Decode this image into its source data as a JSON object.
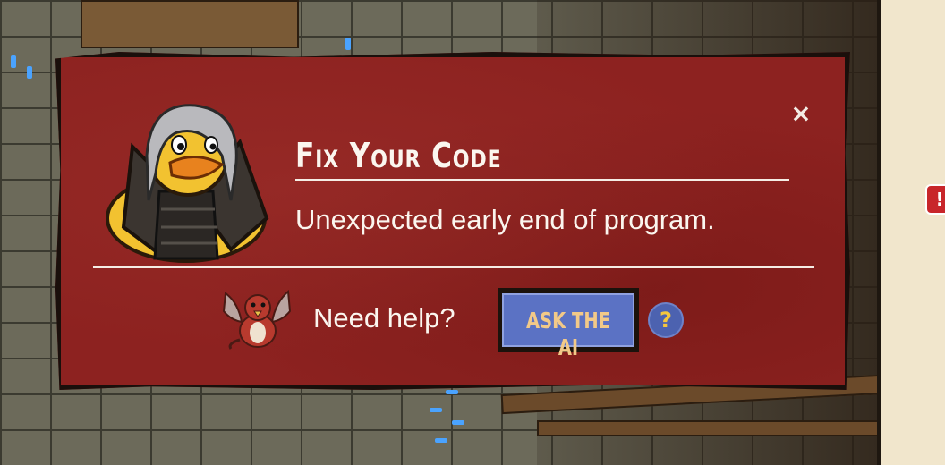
{
  "modal": {
    "title": "Fix Your Code",
    "message": "Unexpected early end of program.",
    "close_glyph": "×",
    "help_prompt": "Need help?",
    "ask_ai_label": "ASK THE AI",
    "help_icon_glyph": "?"
  },
  "background": {
    "alert_glyph": "!"
  },
  "icons": {
    "close": "close-icon",
    "help": "help-icon",
    "avatar": "duck-hero-avatar",
    "pet": "griffin-pet-icon"
  },
  "colors": {
    "modal_bg": "#8d2220",
    "modal_border": "#1a0f0b",
    "button_bg": "#5b72c4",
    "button_text": "#f2c988",
    "help_icon_glyph": "#f3c63e",
    "text": "#fbf6ef"
  }
}
